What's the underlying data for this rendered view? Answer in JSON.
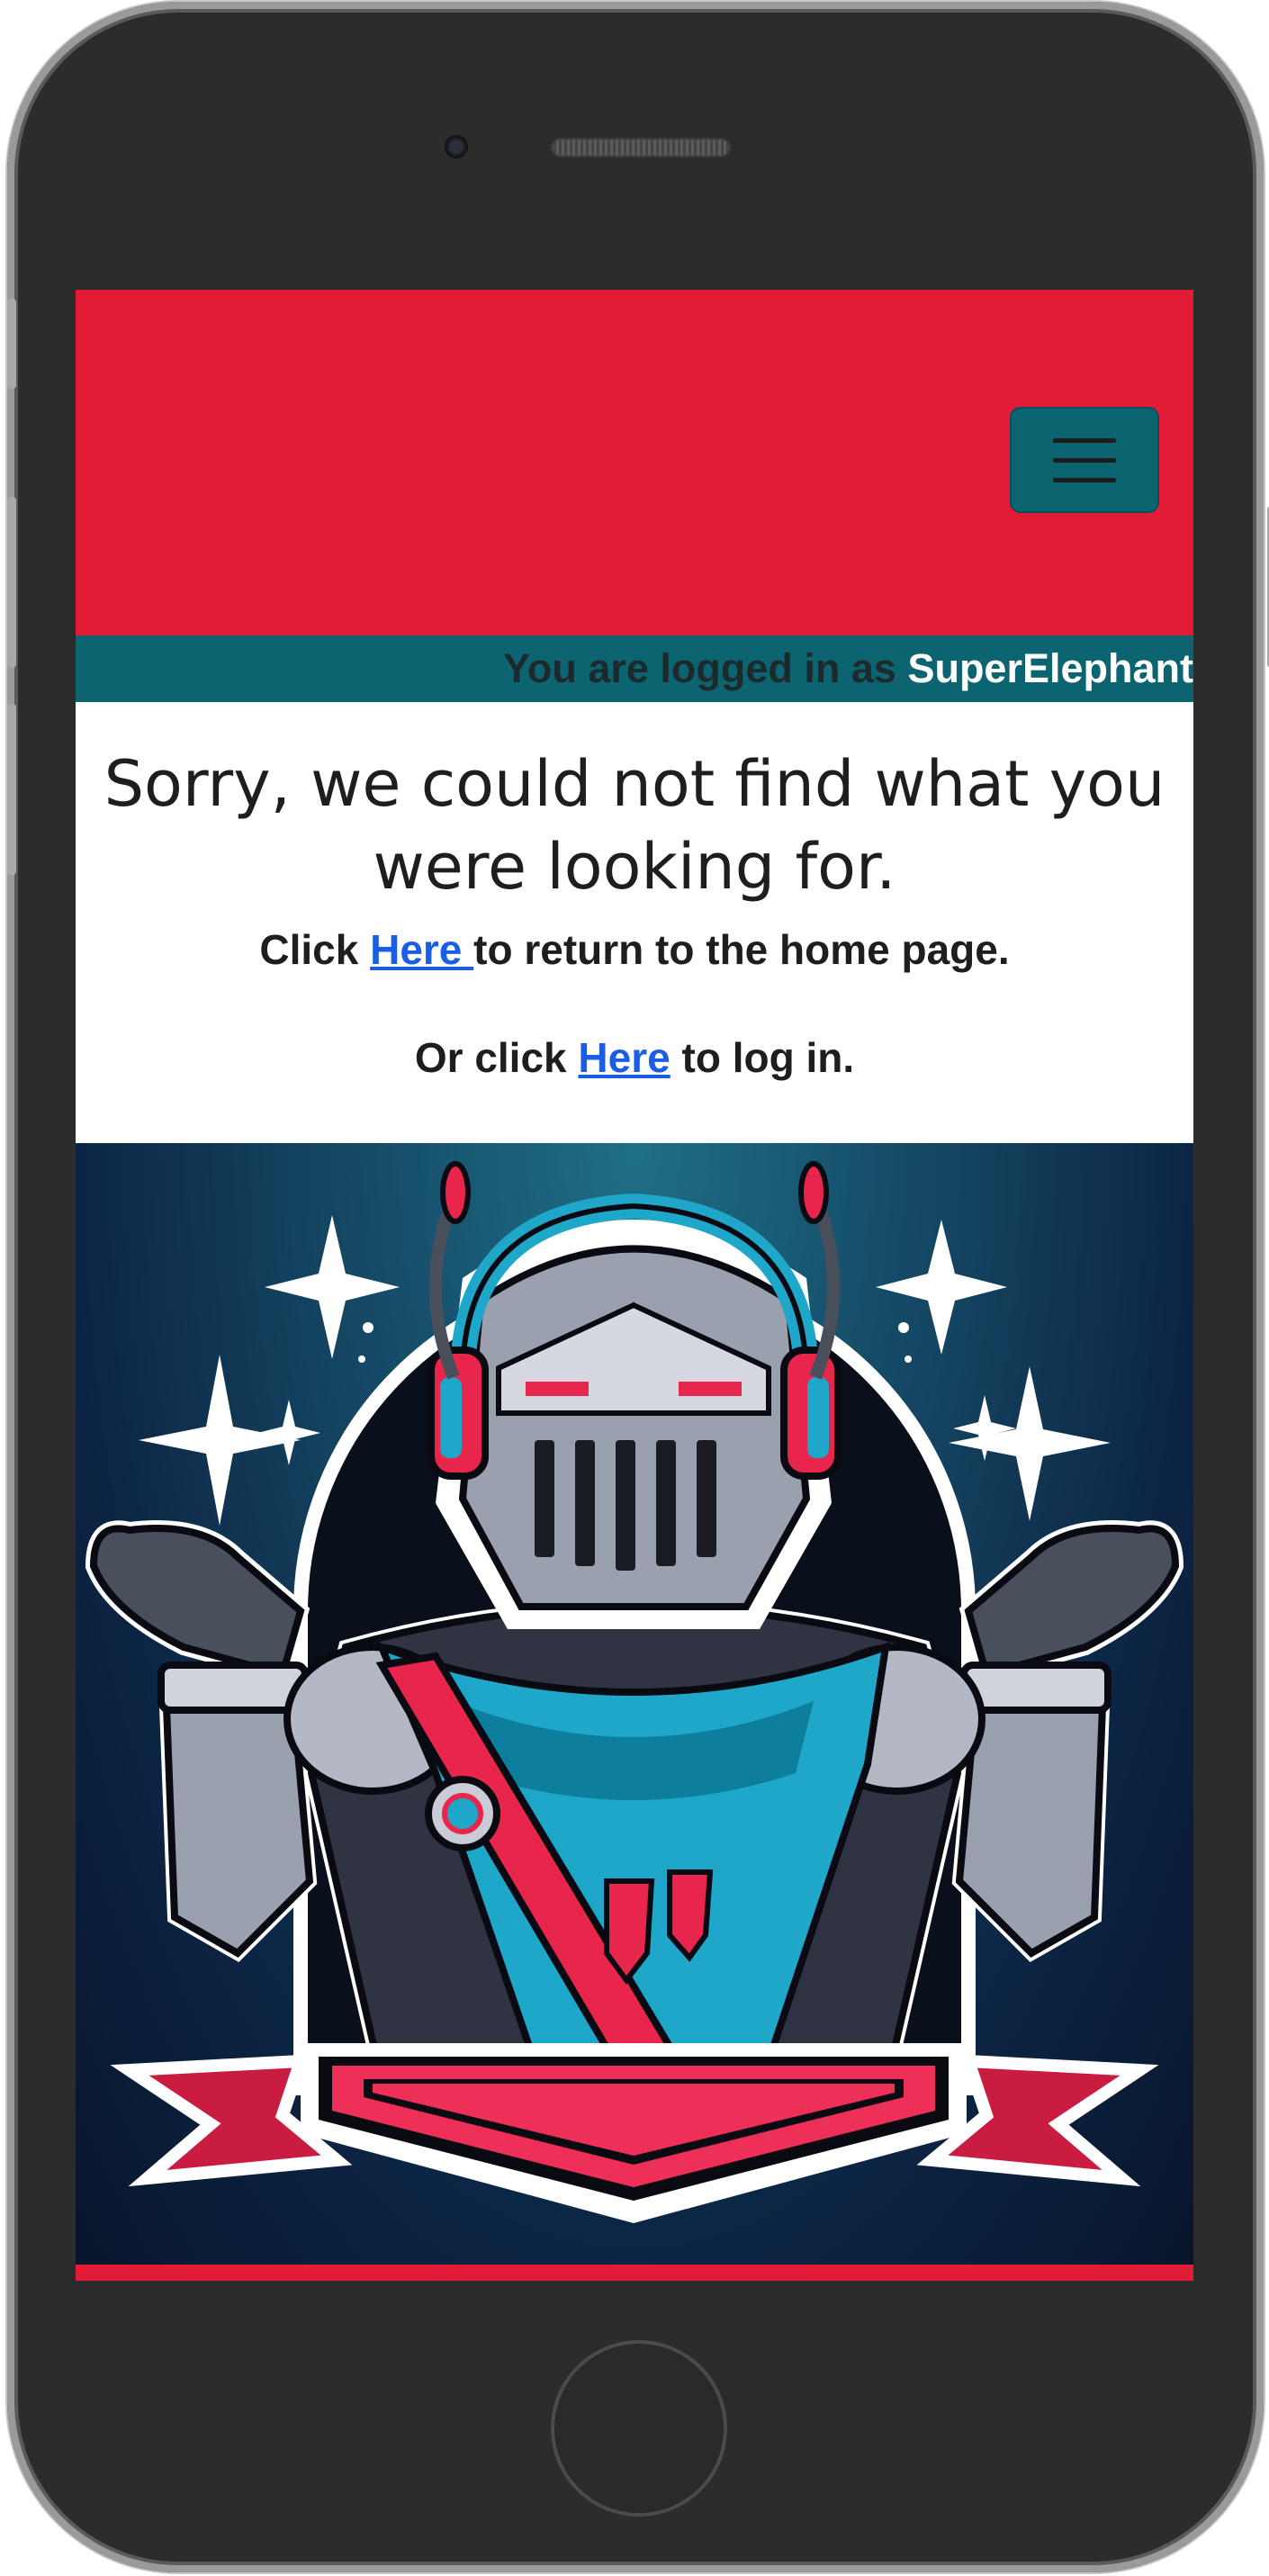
{
  "navbar": {
    "toggle_icon": "hamburger-icon"
  },
  "login": {
    "prefix": "You are logged in as ",
    "username": "SuperElephant"
  },
  "error": {
    "title": "Sorry, we could not find what you were looking for.",
    "home_prefix": "Click ",
    "home_link": "Here ",
    "home_suffix": "to return to the home page.",
    "login_prefix": "Or click ",
    "login_link": "Here",
    "login_suffix": " to log in."
  },
  "colors": {
    "brand_red": "#e21b36",
    "teal": "#0b6470",
    "link": "#1a5ee8"
  },
  "hero": {
    "icon": "shrugging-knight-illustration"
  }
}
